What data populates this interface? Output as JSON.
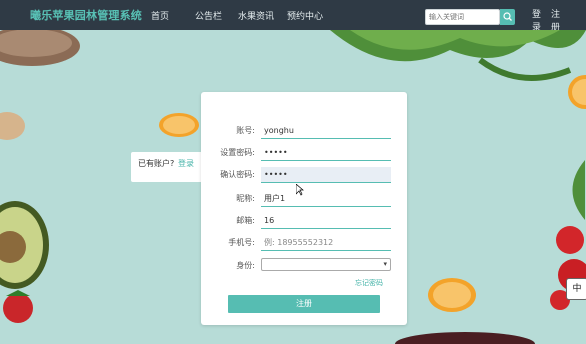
{
  "app": {
    "title": "曦乐苹果园林管理系统"
  },
  "nav": {
    "items": [
      {
        "label": "首页"
      },
      {
        "label": "公告栏"
      },
      {
        "label": "水果资讯"
      },
      {
        "label": "预约中心"
      }
    ]
  },
  "search": {
    "placeholder": "输入关键词"
  },
  "auth": {
    "login_line1": "登",
    "login_line2": "录",
    "register_line1": "注",
    "register_line2": "册"
  },
  "side": {
    "has_account": "已有账户?",
    "login_link": "登录"
  },
  "form": {
    "fields": [
      {
        "label": "账号:",
        "value": "yonghu"
      },
      {
        "label": "设置密码:",
        "value": "•••••"
      },
      {
        "label": "确认密码:",
        "value": "•••••"
      },
      {
        "label": "昵称:",
        "value": "用户1"
      },
      {
        "label": "邮箱:",
        "value": "16"
      },
      {
        "label": "手机号:",
        "placeholder": "例: 18955552312"
      },
      {
        "label": "身份:",
        "value": ""
      }
    ],
    "forgot": "忘记密码",
    "submit": "注册"
  },
  "ime": {
    "label": "中"
  }
}
